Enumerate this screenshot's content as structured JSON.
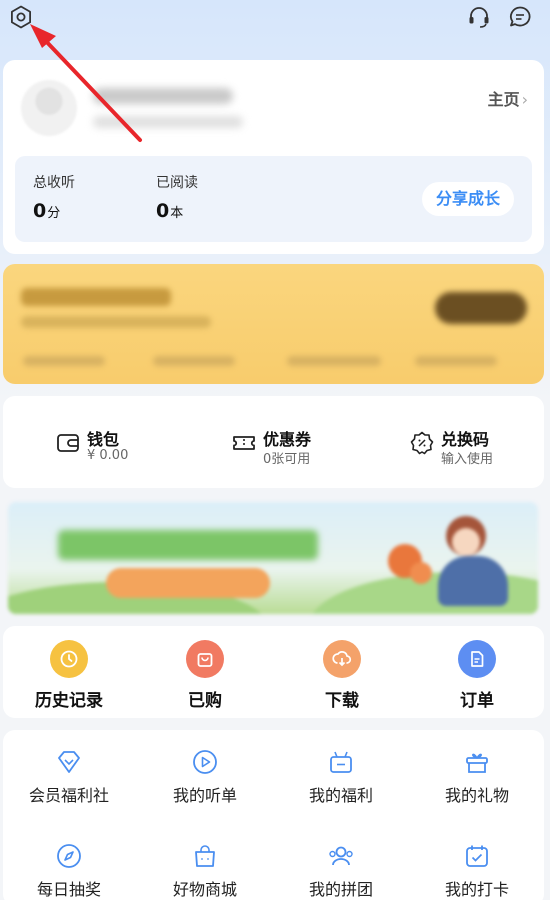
{
  "header": {
    "settings_icon": "gear-icon",
    "service_icon": "headset-icon",
    "message_icon": "message-icon"
  },
  "profile": {
    "home_label": "主页",
    "stats": [
      {
        "label": "总收听",
        "value": "0",
        "unit": "分"
      },
      {
        "label": "已阅读",
        "value": "0",
        "unit": "本"
      }
    ],
    "share_label": "分享成长"
  },
  "wallet": [
    {
      "title": "钱包",
      "subtitle": "¥ 0.00",
      "icon": "wallet-icon"
    },
    {
      "title": "优惠券",
      "subtitle": "0张可用",
      "icon": "ticket-icon"
    },
    {
      "title": "兑换码",
      "subtitle": "输入使用",
      "icon": "coupon-code-icon"
    }
  ],
  "quick": [
    {
      "label": "历史记录",
      "icon": "clock-icon",
      "color": "#f6c241"
    },
    {
      "label": "已购",
      "icon": "bag-icon",
      "color": "#f17a62"
    },
    {
      "label": "下载",
      "icon": "download-icon",
      "color": "#f4a26a"
    },
    {
      "label": "订单",
      "icon": "order-icon",
      "color": "#5d8ef2"
    }
  ],
  "services": [
    {
      "label": "会员福利社",
      "icon": "diamond-icon"
    },
    {
      "label": "我的听单",
      "icon": "play-icon"
    },
    {
      "label": "我的福利",
      "icon": "gift-box-icon"
    },
    {
      "label": "我的礼物",
      "icon": "gift-icon"
    },
    {
      "label": "每日抽奖",
      "icon": "compass-icon"
    },
    {
      "label": "好物商城",
      "icon": "shopping-bag-icon"
    },
    {
      "label": "我的拼团",
      "icon": "group-icon"
    },
    {
      "label": "我的打卡",
      "icon": "checkin-icon"
    }
  ],
  "colors": {
    "accent": "#3b8df5",
    "annotation_arrow": "#e8262b"
  }
}
